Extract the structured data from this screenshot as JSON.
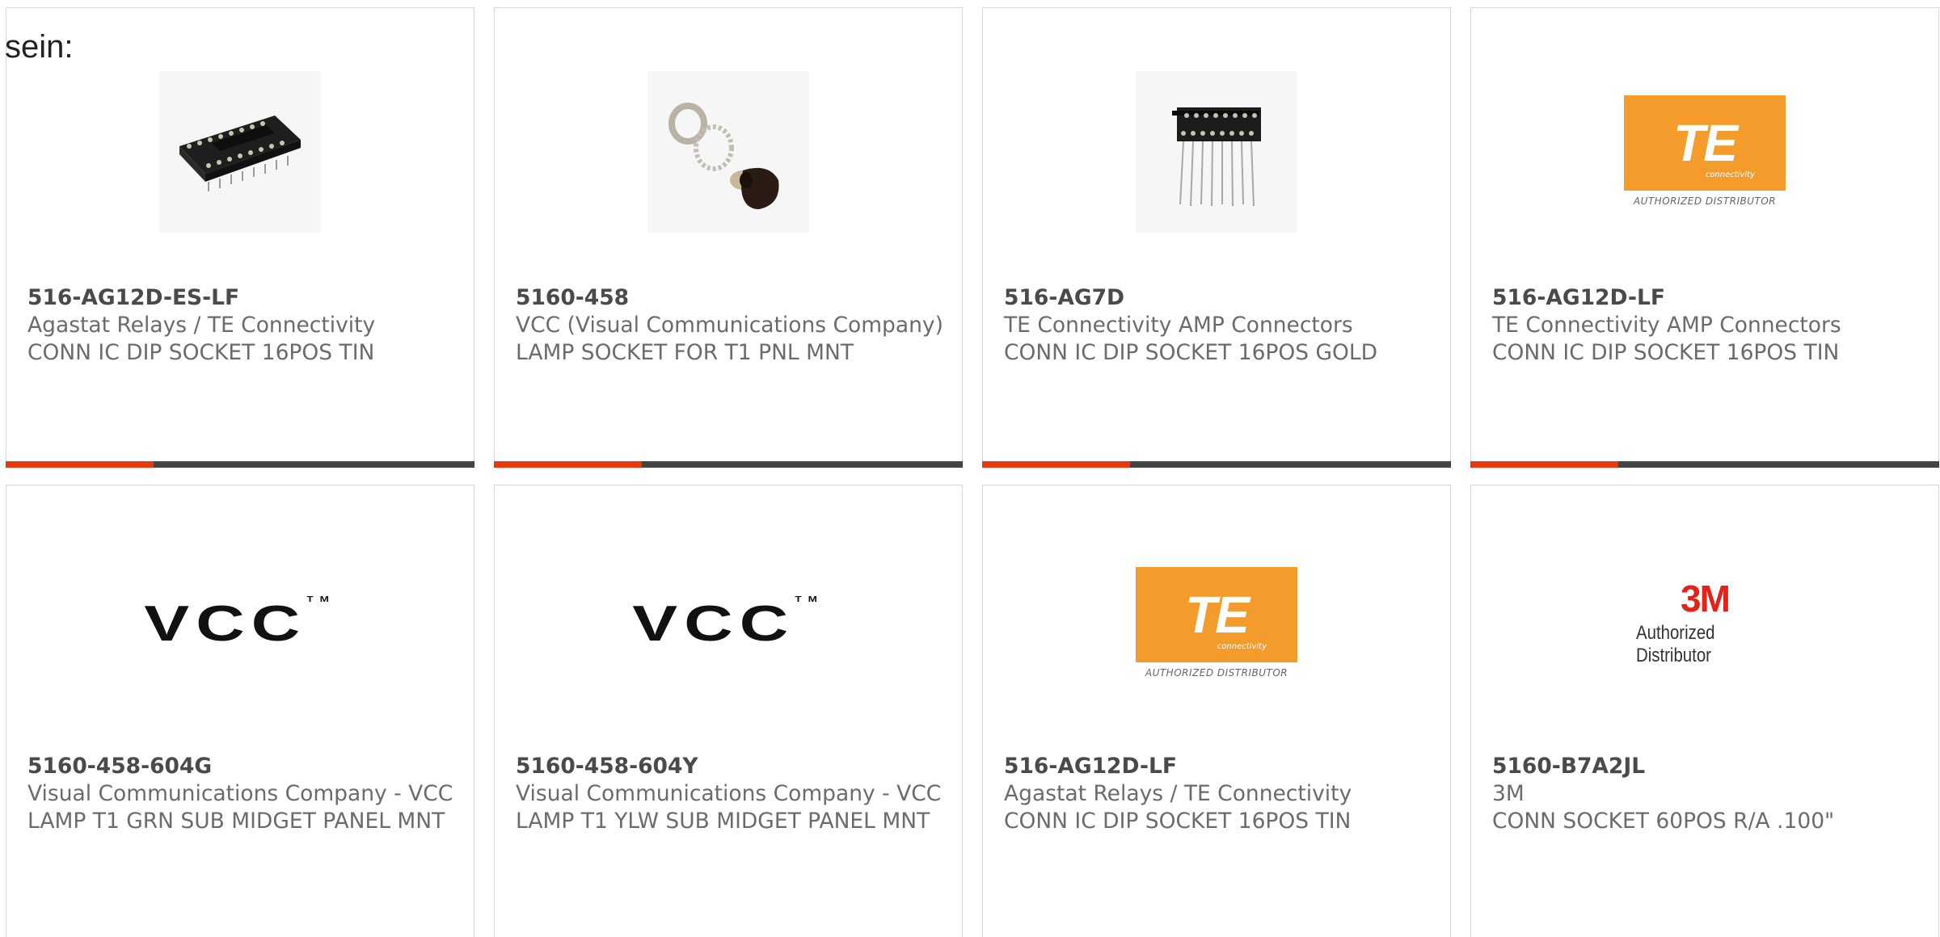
{
  "intro_text": "sein:",
  "colors": {
    "accent": "#e8380d",
    "bar": "#444444",
    "te_orange": "#f39b2b",
    "mmm_red": "#e2231a"
  },
  "logos": {
    "te_mark": "TE",
    "te_sub": "connectivity",
    "te_authorized": "AUTHORIZED DISTRIBUTOR",
    "vcc_mark": "VCC",
    "vcc_tm": "TM",
    "mmm_mark": "3M",
    "mmm_authorized": "Authorized Distributor"
  },
  "products": [
    {
      "part_number": "516-AG12D-ES-LF",
      "manufacturer": "Agastat Relays / TE Connectivity",
      "description": "CONN IC DIP SOCKET 16POS TIN",
      "image": "dip-socket-photo"
    },
    {
      "part_number": "5160-458",
      "manufacturer": "VCC (Visual Communications Company)",
      "description": "LAMP SOCKET FOR T1 PNL MNT",
      "image": "lamp-socket-photo"
    },
    {
      "part_number": "516-AG7D",
      "manufacturer": "TE Connectivity AMP Connectors",
      "description": "CONN IC DIP SOCKET 16POS GOLD",
      "image": "dip-socket-pins-photo"
    },
    {
      "part_number": "516-AG12D-LF",
      "manufacturer": "TE Connectivity AMP Connectors",
      "description": "CONN IC DIP SOCKET 16POS TIN",
      "image": "te-logo"
    },
    {
      "part_number": "5160-458-604G",
      "manufacturer": "Visual Communications Company - VCC",
      "description": "LAMP T1 GRN SUB MIDGET PANEL MNT",
      "image": "vcc-logo"
    },
    {
      "part_number": "5160-458-604Y",
      "manufacturer": "Visual Communications Company - VCC",
      "description": "LAMP T1 YLW SUB MIDGET PANEL MNT",
      "image": "vcc-logo"
    },
    {
      "part_number": "516-AG12D-LF",
      "manufacturer": "Agastat Relays / TE Connectivity",
      "description": "CONN IC DIP SOCKET 16POS TIN",
      "image": "te-logo"
    },
    {
      "part_number": "5160-B7A2JL",
      "manufacturer": "3M",
      "description": "CONN SOCKET 60POS R/A .100\"",
      "image": "3m-logo"
    }
  ]
}
